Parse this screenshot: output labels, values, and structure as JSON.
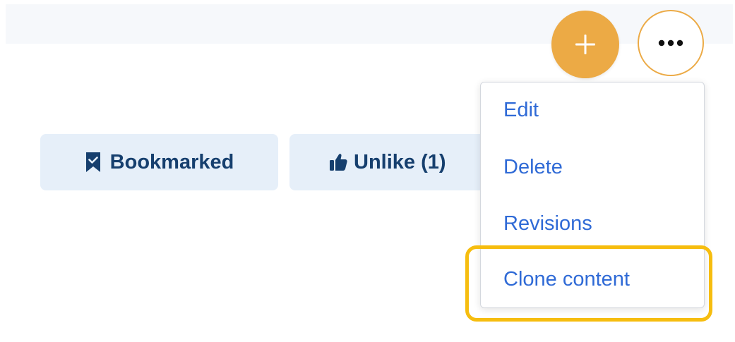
{
  "toolbar": {
    "add_icon": "plus-icon",
    "more_icon": "ellipsis-horizontal-icon"
  },
  "actions": {
    "bookmark": {
      "label": "Bookmarked",
      "icon": "bookmark-check-icon"
    },
    "like": {
      "label": "Unlike (1)",
      "icon": "thumbs-up-icon"
    }
  },
  "menu": {
    "items": [
      {
        "label": "Edit"
      },
      {
        "label": "Delete"
      },
      {
        "label": "Revisions"
      },
      {
        "label": "Clone content"
      }
    ]
  },
  "colors": {
    "accent": "#ecaa45",
    "action_bg": "#e6eff9",
    "action_text": "#163f6e",
    "link": "#2f6ad6",
    "highlight": "#f6bd0f"
  }
}
